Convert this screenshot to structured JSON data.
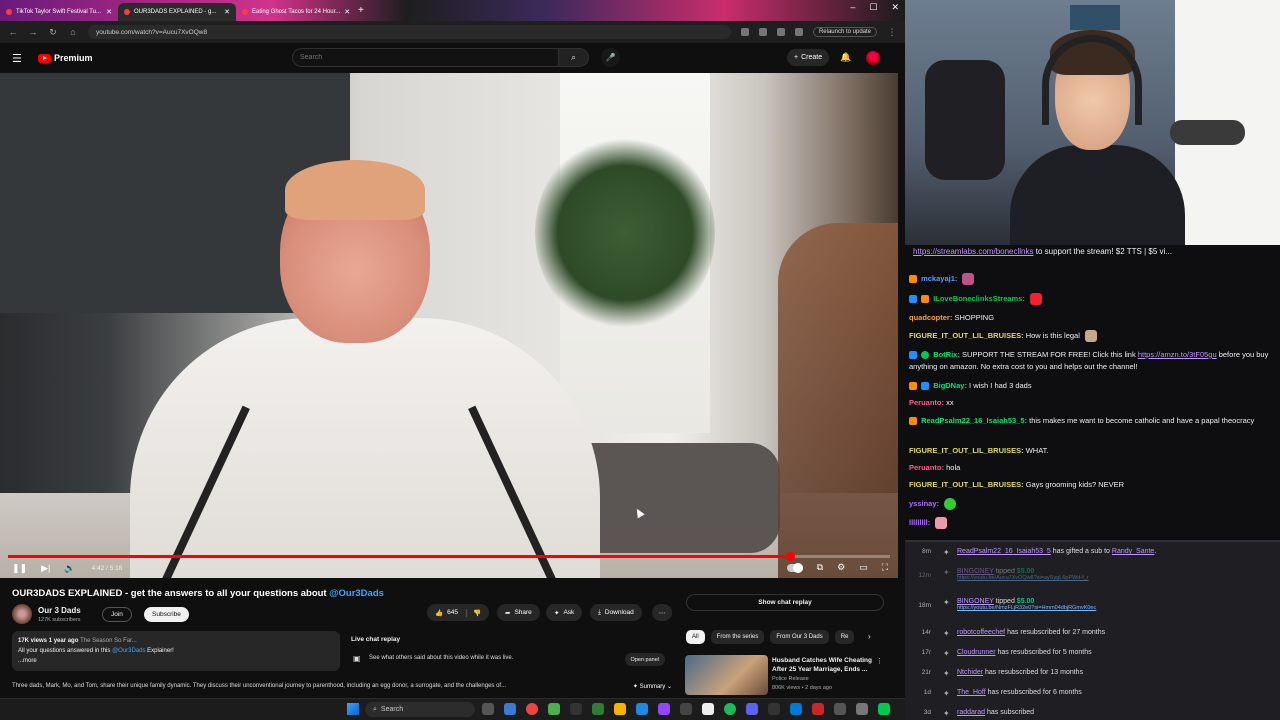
{
  "browser": {
    "tabs": [
      {
        "label": "TikTok Taylor Swift Festival Tu..."
      },
      {
        "label": "OUR3DADS EXPLAINED - g..."
      },
      {
        "label": "Eating Ghost Tacos for 24 Hour..."
      }
    ],
    "url": "youtube.com/watch?v=Aucu7XvOQw8",
    "relaunch_label": "Relaunch to update"
  },
  "youtube": {
    "logo_text": "Premium",
    "search_placeholder": "Search",
    "create_label": "Create",
    "video": {
      "time": "4:42 / 5:18",
      "progress": 0.887
    },
    "title": "OUR3DADS EXPLAINED - get the answers to all your questions about",
    "title_tag": "@Our3Dads",
    "channel": {
      "name": "Our 3 Dads",
      "subscribers": "127K subscribers",
      "join_label": "Join",
      "subscribe_label": "Subscribe"
    },
    "actions": {
      "likes": "645",
      "share": "Share",
      "ask": "Ask",
      "download": "Download"
    },
    "description": {
      "views": "17K views",
      "age": "1 year ago",
      "hashtags": "The Season So Far...",
      "line": "All your questions answered in this",
      "mention": "@Our3Dads",
      "line_end": "Explainer!",
      "more": "...more"
    },
    "live_replay": {
      "heading": "Live chat replay",
      "subtext": "See what others said about this video while it was live.",
      "open_panel": "Open panel"
    },
    "summary_text": "Three dads, Mark, Mo, and Tom, share their unique family dynamic. They discuss their unconventional journey to parenthood, including an egg donor, a surrogate, and the challenges of...",
    "summary_label": "Summary",
    "show_chat": "Show chat replay",
    "chips": [
      "All",
      "From the series",
      "From Our 3 Dads",
      "Re"
    ],
    "recommendation": {
      "title": "Husband Catches Wife Cheating After 25 Year Marriage, Ends ...",
      "source": "Police Release",
      "meta": "806K views • 2 days ago"
    }
  },
  "chat": {
    "banner_link": "https://streamlabs.com/bonecllnks",
    "banner_text": " to support the stream! $2 TTS | $5 vi...",
    "messages": [
      {
        "name": "mckayaj1:",
        "color": "#5b9bff",
        "text": ""
      },
      {
        "name": "ILoveBoneclinksStreams:",
        "color": "#00c853",
        "text": ""
      },
      {
        "name": "quadcopter:",
        "color": "#ff9e3b",
        "text": "SHOPPING"
      },
      {
        "name": "FIGURE_IT_OUT_LIL_BRUISES:",
        "color": "#dfd95a",
        "text": "How is this legal"
      },
      {
        "name": "BotRix:",
        "color": "#00e676",
        "text": "SUPPORT THE STREAM FOR FREE! Click this link ",
        "link": "https://amzn.to/3tF05gu",
        "text2": "before you buy anything on amazon. No extra cost to you and helps out the channel!"
      },
      {
        "name": "BigDNay:",
        "color": "#00e676",
        "text": "I wish I had 3 dads"
      },
      {
        "name": "Peruanto:",
        "color": "#ff5c8a",
        "text": "xx"
      },
      {
        "name": "ReadPsalm22_16_Isaiah53_5:",
        "color": "#00e676",
        "text": "this makes me want to become catholic and have a papal theocracy"
      },
      {
        "name": "FIGURE_IT_OUT_LIL_BRUISES:",
        "color": "#dfd95a",
        "text": "WHAT."
      },
      {
        "name": "Peruanto:",
        "color": "#ff5c8a",
        "text": "hola"
      },
      {
        "name": "FIGURE_IT_OUT_LIL_BRUISES:",
        "color": "#dfd95a",
        "text": "Gays grooming kids? NEVER"
      },
      {
        "name": "yssinay:",
        "color": "#b06bff",
        "text": ""
      },
      {
        "name": "lllllllll:",
        "color": "#b06bff",
        "text": ""
      }
    ]
  },
  "feed": [
    {
      "time": "8m",
      "user": "ReadPsalm22_16_Isaiah53_5",
      "text": " has gifted a sub to ",
      "target": "Randy_Sante",
      "end": "."
    },
    {
      "time": "12m",
      "user": "BINGONEY",
      "text": " tipped ",
      "money": "$5.00",
      "link": "https://youtu.be/Aucu7XvOQw8?si=aySygL6pPWd-f_r",
      "dim": true
    },
    {
      "time": "18m",
      "user": "BINGONEY",
      "text": " tipped ",
      "money": "$5.00",
      "link": "https://youtu.be/NmzFLjR32e0?si=Hmm04dbjRGmvK0ec"
    },
    {
      "time": "14r",
      "user": "robotcoffeechef",
      "text": " has resubscribed for 27 months"
    },
    {
      "time": "17r",
      "user": "Cloudrunner",
      "text": " has resubscribed for 5 months"
    },
    {
      "time": "21r",
      "user": "Ntchider",
      "text": " has resubscribed for 13 months"
    },
    {
      "time": "1d",
      "user": "The_Hoff",
      "text": " has resubscribed for 6 months"
    },
    {
      "time": "3d",
      "user": "raddarad",
      "text": " has subscribed"
    }
  ],
  "taskbar": {
    "search_label": "Search"
  }
}
